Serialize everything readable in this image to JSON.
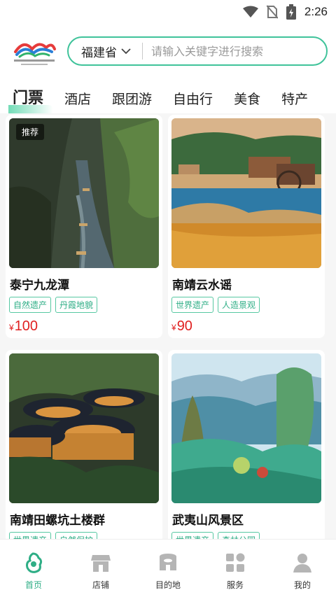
{
  "status_bar": {
    "time": "2:26"
  },
  "header": {
    "logo_alt": "福建旅游",
    "province": "福建省",
    "search_placeholder": "请输入关键字进行搜索"
  },
  "tabs": [
    "门票",
    "酒店",
    "跟团游",
    "自由行",
    "美食",
    "特产"
  ],
  "cards": [
    {
      "badge": "推荐",
      "title": "泰宁九龙潭",
      "tags": [
        "自然遗产",
        "丹霞地貌"
      ],
      "currency": "¥",
      "price": "100"
    },
    {
      "badge": "",
      "title": "南靖云水谣",
      "tags": [
        "世界遗产",
        "人造景观"
      ],
      "currency": "¥",
      "price": "90"
    },
    {
      "badge": "",
      "title": "南靖田螺坑土楼群",
      "tags": [
        "世界遗产",
        "自然保护"
      ],
      "currency": "",
      "price": ""
    },
    {
      "badge": "",
      "title": "武夷山风景区",
      "tags": [
        "世界遗产",
        "森林公园"
      ],
      "currency": "",
      "price": ""
    }
  ],
  "bottom_nav": [
    "首页",
    "店铺",
    "目的地",
    "服务",
    "我的"
  ],
  "colors": {
    "accent": "#3fc39a",
    "price": "#e02020"
  }
}
